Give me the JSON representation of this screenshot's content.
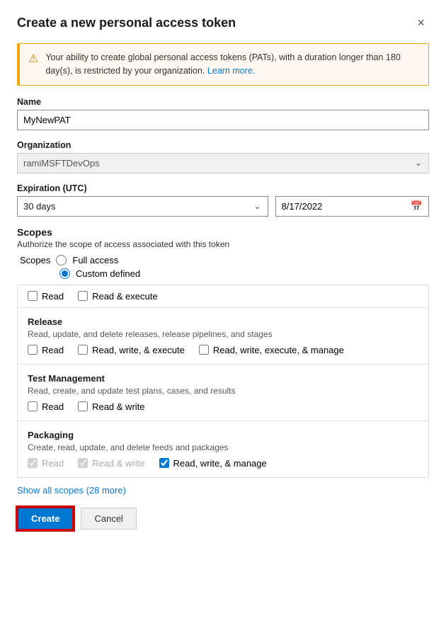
{
  "dialog": {
    "title": "Create a new personal access token",
    "close_label": "×"
  },
  "warning": {
    "icon": "⚠",
    "text": "Your ability to create global personal access tokens (PATs), with a duration longer than 180 day(s), is restricted by your organization.",
    "link_text": "Learn more.",
    "link_href": "#"
  },
  "form": {
    "name_label": "Name",
    "name_placeholder": "",
    "name_value": "MyNewPAT",
    "organization_label": "Organization",
    "organization_value": "ramiMSFTDevOps",
    "expiration_label": "Expiration (UTC)",
    "expiration_option": "30 days",
    "expiration_date": "8/17/2022",
    "calendar_icon": "📅"
  },
  "scopes": {
    "title": "Scopes",
    "description": "Authorize the scope of access associated with this token",
    "scopes_label": "Scopes",
    "full_access_label": "Full access",
    "custom_defined_label": "Custom defined",
    "custom_defined_selected": true,
    "truncated_options": [
      {
        "label": "Read",
        "checked": false
      },
      {
        "label": "Read & execute",
        "checked": false
      }
    ],
    "sections": [
      {
        "id": "release",
        "title": "Release",
        "description": "Read, update, and delete releases, release pipelines, and stages",
        "options": [
          {
            "label": "Read",
            "checked": false,
            "disabled": false
          },
          {
            "label": "Read, write, & execute",
            "checked": false,
            "disabled": false
          },
          {
            "label": "Read, write, execute, & manage",
            "checked": false,
            "disabled": false
          }
        ]
      },
      {
        "id": "test-management",
        "title": "Test Management",
        "description": "Read, create, and update test plans, cases, and results",
        "options": [
          {
            "label": "Read",
            "checked": false,
            "disabled": false
          },
          {
            "label": "Read & write",
            "checked": false,
            "disabled": false
          }
        ]
      },
      {
        "id": "packaging",
        "title": "Packaging",
        "description": "Create, read, update, and delete feeds and packages",
        "options": [
          {
            "label": "Read",
            "checked": true,
            "disabled": true
          },
          {
            "label": "Read & write",
            "checked": true,
            "disabled": true
          },
          {
            "label": "Read, write, & manage",
            "checked": true,
            "disabled": false
          }
        ]
      }
    ]
  },
  "show_all": {
    "text": "Show all scopes",
    "count": "(28 more)"
  },
  "footer": {
    "create_label": "Create",
    "cancel_label": "Cancel"
  }
}
